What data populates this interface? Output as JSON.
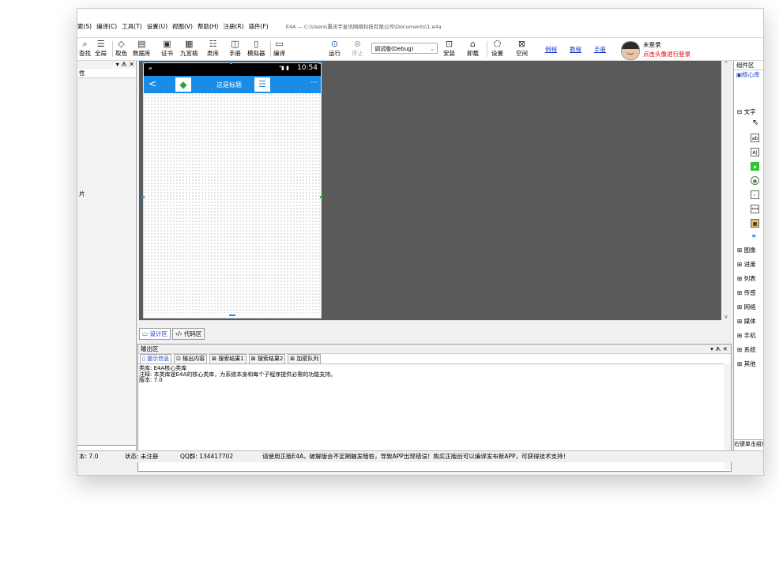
{
  "window": {
    "title": "E4A — C:\\Users\\重庆宇星讯网络科技有限公司\\Documents\\1.e4a",
    "menu": [
      "索(S)",
      "编译(C)",
      "工具(T)",
      "设置(U)",
      "视图(V)",
      "帮助(H)",
      "注册(R)",
      "插件(F)"
    ]
  },
  "toolbar": {
    "buttons": [
      {
        "label": "查找",
        "icon": "search-icon"
      },
      {
        "label": "全局",
        "icon": "global-search-icon"
      },
      {
        "label": "取色",
        "icon": "color-picker-icon"
      },
      {
        "label": "数据库",
        "icon": "database-icon"
      },
      {
        "label": "证书",
        "icon": "certificate-icon"
      },
      {
        "label": "九宫格",
        "icon": "grid-icon"
      },
      {
        "label": "类库",
        "icon": "library-icon"
      },
      {
        "label": "手册",
        "icon": "manual-icon"
      },
      {
        "label": "模拟器",
        "icon": "emulator-icon"
      },
      {
        "label": "编译",
        "icon": "compile-icon"
      },
      {
        "label": "运行",
        "icon": "run-icon"
      },
      {
        "label": "停止",
        "icon": "stop-icon",
        "disabled": true
      },
      {
        "label": "安装",
        "icon": "install-icon"
      },
      {
        "label": "卸载",
        "icon": "uninstall-icon"
      },
      {
        "label": "设置",
        "icon": "settings-icon"
      },
      {
        "label": "空间",
        "icon": "space-icon"
      }
    ],
    "build_mode": "调试版(Debug)",
    "links": [
      "例程",
      "教程",
      "手册"
    ],
    "login_status": "未登录",
    "login_prompt": "点击头像进行登录"
  },
  "left_panel": {
    "controls": "▾ ᗑ ✕",
    "row_label": "性",
    "side_label": "片"
  },
  "phone": {
    "time": "10:54",
    "title": "这是标题",
    "back": "<",
    "more": "···"
  },
  "design_tabs": [
    "设计区",
    "代码区"
  ],
  "output": {
    "title": "输出区",
    "controls": "▾ ᗑ ✕",
    "tabs": [
      "提示信息",
      "输出内容",
      "搜索结果1",
      "搜索结果2",
      "加密队列"
    ],
    "lines": [
      "类库: E4A核心类库",
      "注释: 本类库是E4A的核心类库，为系统本身和每个子程序提供必需的功能支持。",
      "版本: 7.0"
    ]
  },
  "components": {
    "title": "组件区",
    "core": "核心库",
    "text_group": "文字",
    "groups": [
      "图像",
      "进度",
      "列表",
      "传感",
      "网络",
      "媒体",
      "手机",
      "系统",
      "其他"
    ],
    "footer": "右键单击组件"
  },
  "status": {
    "version": "本: 7.0",
    "state": "状态: 未注册",
    "qq": "QQ群: 134417702",
    "message": "请使用正版E4A，破解版会不定期触发暗桩，导致APP出现错误！购买正版后可以编译发布新APP，可获得技术支持！"
  }
}
